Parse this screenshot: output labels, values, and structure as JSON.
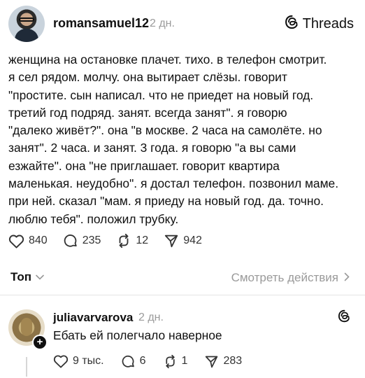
{
  "post": {
    "username": "romansamuel12",
    "time": "2 дн.",
    "brand_label": "Threads",
    "lines": [
      "женщина на остановке плачет. тихо. в телефон смотрит.",
      "я сел рядом. молчу. она вытирает слёзы. говорит",
      "\"простите. сын написал. что не приедет на новый год.",
      "третий год подряд. занят. всегда занят\". я говорю",
      "\"далеко живёт?\". она \"в москве. 2 часа на самолёте. но",
      "занят\". 2 часа. и занят. 3 года. я говорю \"а вы сами",
      "езжайте\". она \"не приглашает. говорит квартира",
      "маленькая. неудобно\". я достал телефон. позвонил маме.",
      "при ней. сказал \"мам. я приеду на новый год. да. точно.",
      "люблю тебя\". положил трубку."
    ],
    "stats": {
      "likes": "840",
      "comments": "235",
      "reposts": "12",
      "shares": "942"
    }
  },
  "sort": {
    "label": "Топ",
    "view_activity": "Смотреть действия"
  },
  "reply": {
    "username": "juliavarvarova",
    "time": "2 дн.",
    "text": "Ебать ей полегчало наверное",
    "stats": {
      "likes": "9 тыс.",
      "comments": "6",
      "reposts": "1",
      "shares": "283"
    }
  },
  "icons": {
    "like": "heart-icon",
    "comment": "comment-bubble-icon",
    "repost": "repost-icon",
    "share": "send-icon",
    "brand": "threads-logo-icon",
    "sort": "chevron-down-icon",
    "view": "chevron-right-icon",
    "follow": "plus-icon"
  }
}
